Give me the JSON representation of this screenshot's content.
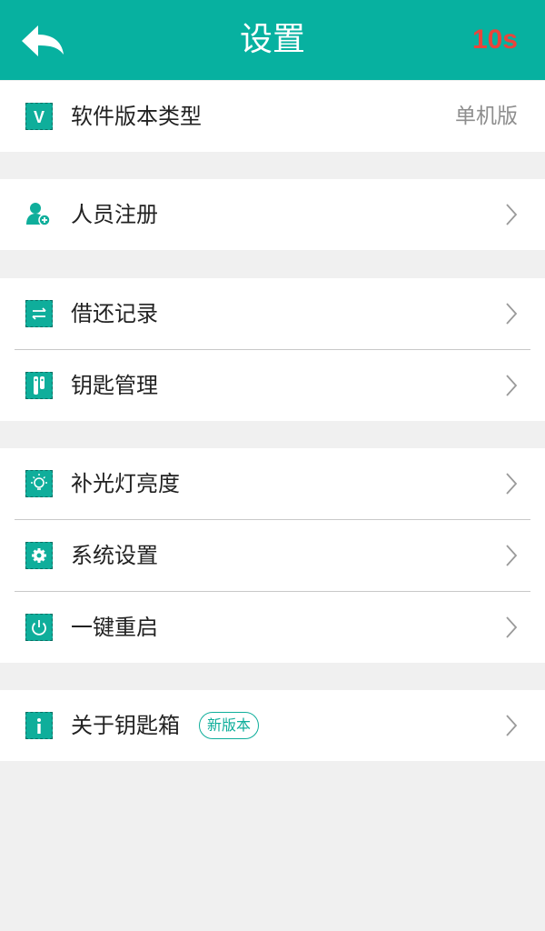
{
  "header": {
    "title": "设置",
    "countdown": "10s",
    "back_icon": "back-arrow-icon"
  },
  "colors": {
    "accent": "#07b1a0",
    "countdown": "#e8453c",
    "background": "#f0f0f0"
  },
  "groups": [
    {
      "items": [
        {
          "icon": "version-v-icon",
          "label": "软件版本类型",
          "value": "单机版"
        }
      ]
    },
    {
      "items": [
        {
          "icon": "user-add-icon",
          "label": "人员注册",
          "chevron": "chevron-right-icon"
        }
      ]
    },
    {
      "items": [
        {
          "icon": "transfer-icon",
          "label": "借还记录",
          "chevron": "chevron-right-icon"
        },
        {
          "icon": "key-icon",
          "label": "钥匙管理",
          "chevron": "chevron-right-icon"
        }
      ]
    },
    {
      "items": [
        {
          "icon": "light-bulb-icon",
          "label": "补光灯亮度",
          "chevron": "chevron-right-icon"
        },
        {
          "icon": "gear-icon",
          "label": "系统设置",
          "chevron": "chevron-right-icon"
        },
        {
          "icon": "power-icon",
          "label": "一键重启",
          "chevron": "chevron-right-icon"
        }
      ]
    },
    {
      "items": [
        {
          "icon": "info-icon",
          "label": "关于钥匙箱",
          "badge": "新版本",
          "chevron": "chevron-right-icon"
        }
      ]
    }
  ]
}
